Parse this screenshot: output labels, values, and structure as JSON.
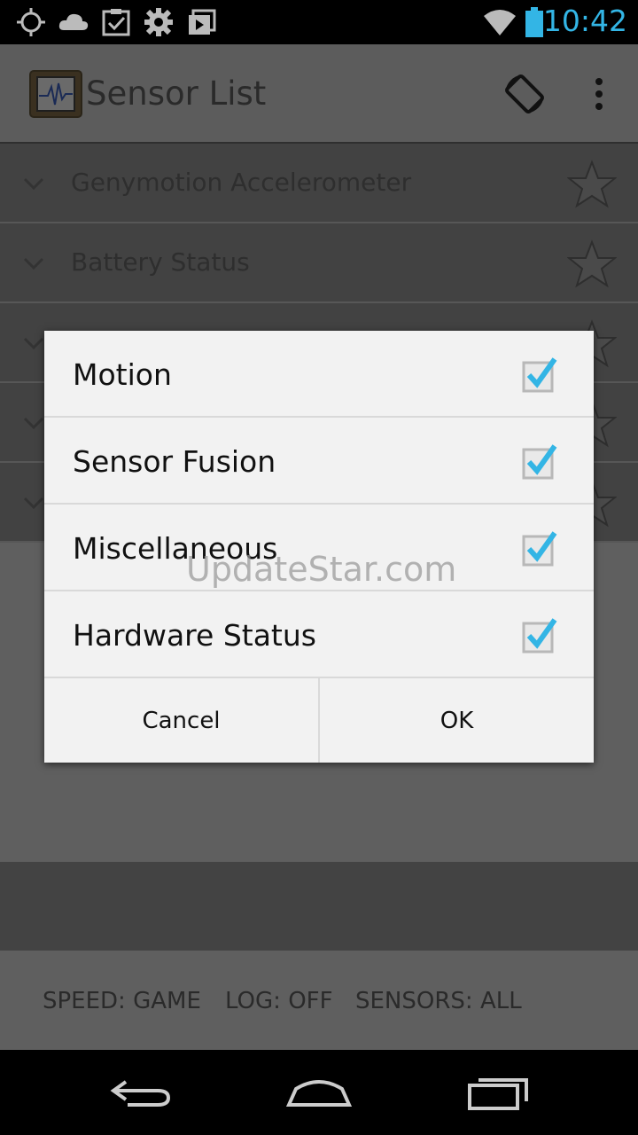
{
  "status_bar": {
    "time": "10:42",
    "icons": [
      "gps-icon",
      "cloud-icon",
      "clipboard-check-icon",
      "gear-icon",
      "photo-stack-icon",
      "wifi-icon",
      "battery-icon"
    ],
    "accent_color": "#33b5e5"
  },
  "action_bar": {
    "title": "Sensor List",
    "icons": [
      "app-icon",
      "screen-rotate-icon",
      "overflow-menu-icon"
    ]
  },
  "list": {
    "items": [
      {
        "label": "Genymotion Accelerometer"
      },
      {
        "label": "Battery Status"
      },
      {
        "label": ""
      },
      {
        "label": ""
      },
      {
        "label": ""
      }
    ]
  },
  "dialog": {
    "options": [
      {
        "label": "Motion",
        "checked": true
      },
      {
        "label": "Sensor Fusion",
        "checked": true
      },
      {
        "label": "Miscellaneous",
        "checked": true
      },
      {
        "label": "Hardware Status",
        "checked": true
      }
    ],
    "cancel_label": "Cancel",
    "ok_label": "OK",
    "check_color": "#33b5e5"
  },
  "footer": {
    "speed": "SPEED: GAME",
    "log": "LOG: OFF",
    "sensors": "SENSORS: ALL"
  },
  "watermark": "UpdateStar.com"
}
